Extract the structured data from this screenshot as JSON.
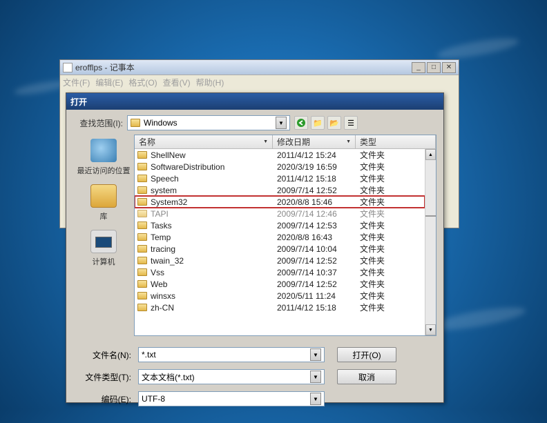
{
  "notepad": {
    "title": "erofflps - 记事本",
    "menu": {
      "file": "文件(F)",
      "edit": "编辑(E)",
      "format": "格式(O)",
      "view": "查看(V)",
      "help": "帮助(H)"
    }
  },
  "dialog": {
    "title": "打开",
    "lookin_label": "查找范围(I):",
    "lookin_value": "Windows",
    "places": {
      "recent": "最近访问的位置",
      "library": "库",
      "computer": "计算机"
    },
    "columns": {
      "name": "名称",
      "date": "修改日期",
      "type": "类型"
    },
    "rows": [
      {
        "name": "ShellNew",
        "date": "2011/4/12 15:24",
        "type": "文件夹"
      },
      {
        "name": "SoftwareDistribution",
        "date": "2020/3/19 16:59",
        "type": "文件夹"
      },
      {
        "name": "Speech",
        "date": "2011/4/12 15:18",
        "type": "文件夹"
      },
      {
        "name": "system",
        "date": "2009/7/14 12:52",
        "type": "文件夹"
      },
      {
        "name": "System32",
        "date": "2020/8/8 15:46",
        "type": "文件夹",
        "highlight": true
      },
      {
        "name": "TAPI",
        "date": "2009/7/14 12:46",
        "type": "文件夹",
        "fade": true
      },
      {
        "name": "Tasks",
        "date": "2009/7/14 12:53",
        "type": "文件夹"
      },
      {
        "name": "Temp",
        "date": "2020/8/8 16:43",
        "type": "文件夹"
      },
      {
        "name": "tracing",
        "date": "2009/7/14 10:04",
        "type": "文件夹"
      },
      {
        "name": "twain_32",
        "date": "2009/7/14 12:52",
        "type": "文件夹"
      },
      {
        "name": "Vss",
        "date": "2009/7/14 10:37",
        "type": "文件夹"
      },
      {
        "name": "Web",
        "date": "2009/7/14 12:52",
        "type": "文件夹"
      },
      {
        "name": "winsxs",
        "date": "2020/5/11 11:24",
        "type": "文件夹"
      },
      {
        "name": "zh-CN",
        "date": "2011/4/12 15:18",
        "type": "文件夹"
      }
    ],
    "filename_label": "文件名(N):",
    "filename_value": "*.txt",
    "filetype_label": "文件类型(T):",
    "filetype_value": "文本文档(*.txt)",
    "encoding_label": "编码(E):",
    "encoding_value": "UTF-8",
    "open_btn": "打开(O)",
    "cancel_btn": "取消"
  }
}
